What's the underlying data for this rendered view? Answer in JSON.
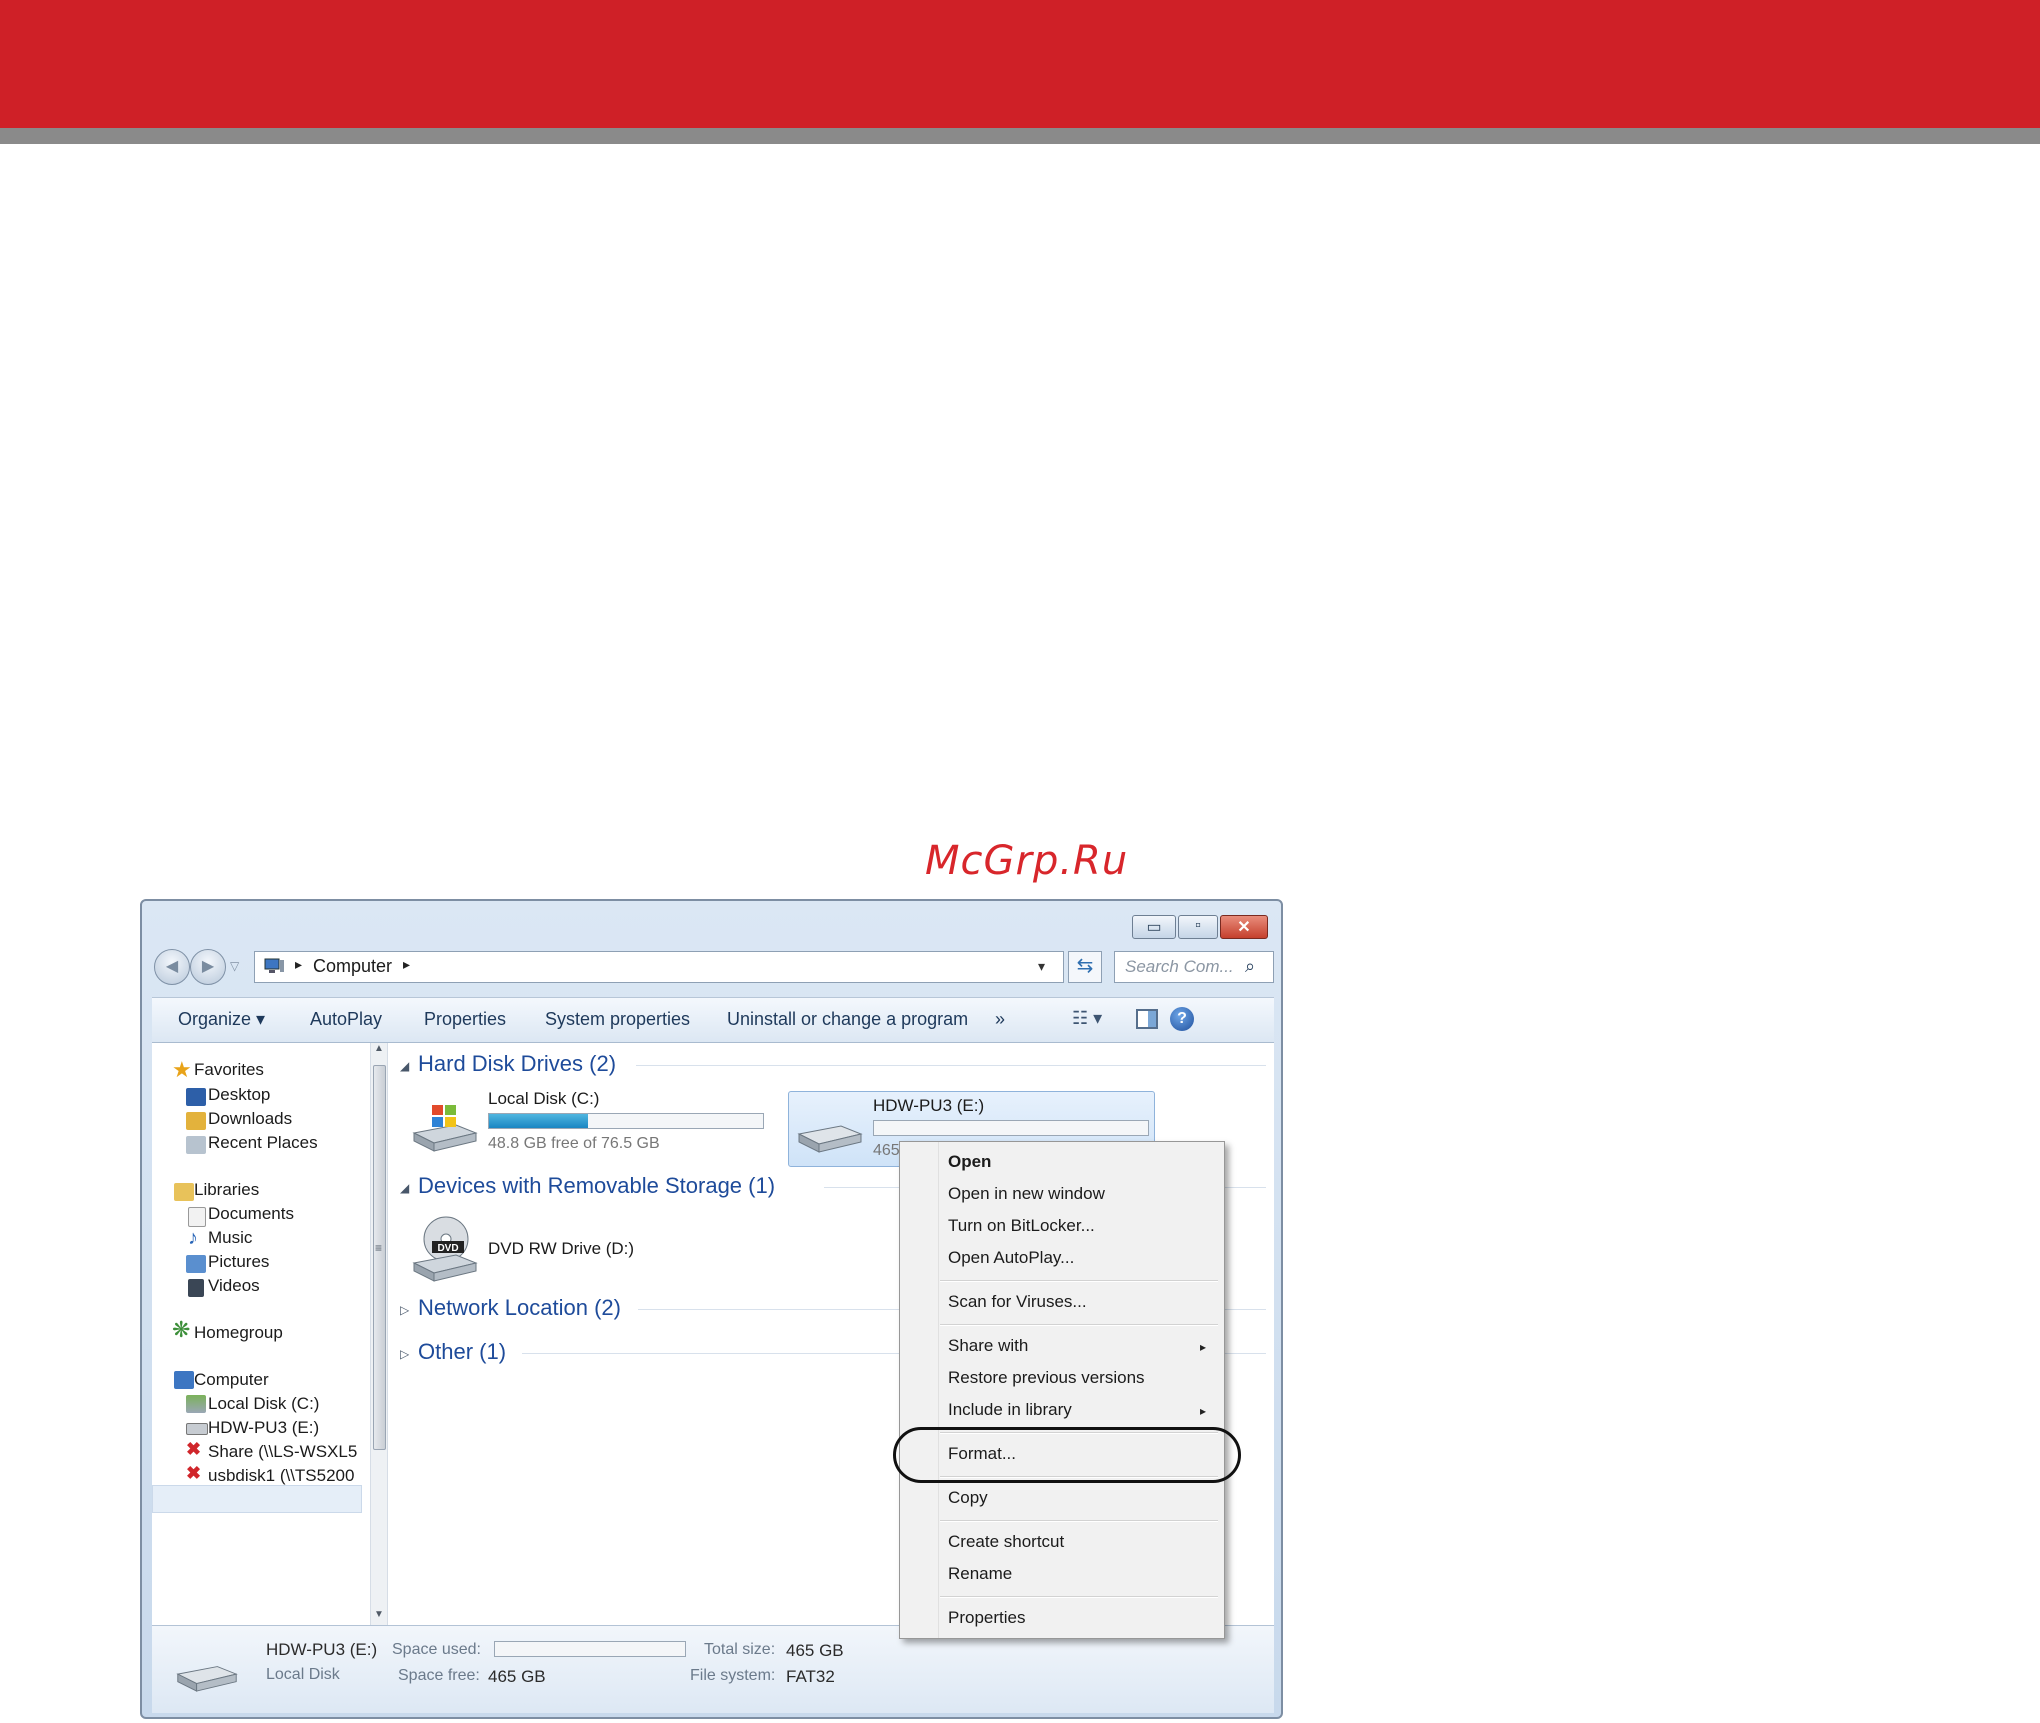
{
  "watermark": "McGrp.Ru",
  "window": {
    "caption_buttons": {
      "minimize": "▭",
      "maximize": "▫",
      "close": "✕"
    },
    "address": {
      "location": "Computer",
      "arrow": "▸",
      "dropdown": "▾",
      "refresh": "⇆"
    },
    "search": {
      "placeholder": "Search Com...",
      "icon": "⌕"
    },
    "toolbar": {
      "organize": "Organize ▾",
      "autoplay": "AutoPlay",
      "properties": "Properties",
      "system_properties": "System properties",
      "uninstall": "Uninstall or change a program",
      "more": "»",
      "views": "☷ ▾",
      "help": "?"
    },
    "nav": {
      "favorites": "Favorites",
      "desktop": "Desktop",
      "downloads": "Downloads",
      "recent_places": "Recent Places",
      "libraries": "Libraries",
      "documents": "Documents",
      "music": "Music",
      "pictures": "Pictures",
      "videos": "Videos",
      "homegroup": "Homegroup",
      "computer": "Computer",
      "local_disk": "Local Disk (C:)",
      "hdw": "HDW-PU3 (E:)",
      "share": "Share (\\\\LS-WSXL5",
      "usbdisk": "usbdisk1 (\\\\TS5200"
    },
    "groups": {
      "hard_disk": "Hard Disk Drives (2)",
      "removable": "Devices with Removable Storage (1)",
      "network": "Network Location (2)",
      "other": "Other (1)"
    },
    "drives": {
      "c": {
        "name": "Local Disk (C:)",
        "free_text": "48.8 GB free of 76.5 GB",
        "used_fraction": 0.36
      },
      "e": {
        "name": "HDW-PU3 (E:)",
        "free_text_partial": "465",
        "used_fraction": 0.0
      },
      "d": {
        "name": "DVD RW Drive (D:)",
        "badge": "DVD"
      }
    },
    "details": {
      "name": "HDW-PU3 (E:)",
      "type": "Local Disk",
      "space_used_label": "Space used:",
      "space_free_label": "Space free:",
      "space_free_value": "465 GB",
      "total_size_label": "Total size:",
      "total_size_value": "465 GB",
      "file_system_label": "File system:",
      "file_system_value": "FAT32"
    }
  },
  "context_menu": {
    "open": "Open",
    "open_new_window": "Open in new window",
    "bitlocker": "Turn on BitLocker...",
    "autoplay": "Open AutoPlay...",
    "scan": "Scan for Viruses...",
    "share_with": "Share with",
    "restore": "Restore previous versions",
    "include_library": "Include in library",
    "format": "Format...",
    "copy": "Copy",
    "create_shortcut": "Create shortcut",
    "rename": "Rename",
    "properties": "Properties",
    "submenu_arrow": "▸"
  },
  "colors": {
    "brand_red": "#cf2027",
    "band_grey": "#8a8a8a",
    "group_blue": "#1e4b9a",
    "capacity_blue": "#1b86c2"
  }
}
